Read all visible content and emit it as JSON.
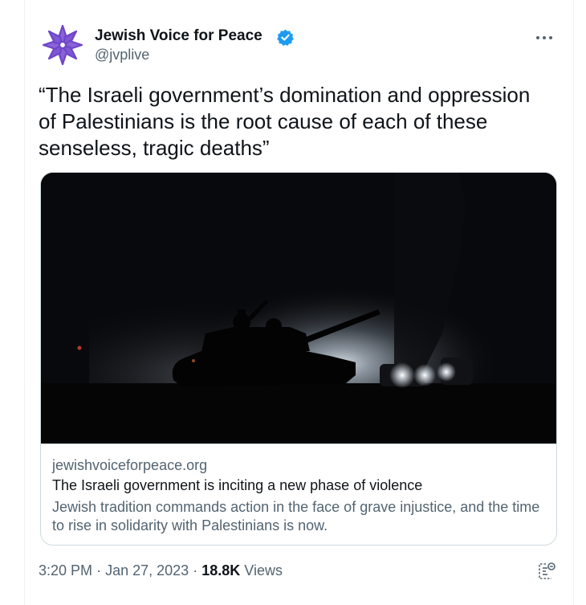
{
  "author": {
    "name": "Jewish Voice for Peace",
    "handle": "@jvplive",
    "verified": true
  },
  "tweet": {
    "text": "“The Israeli government’s domination and oppression of Palestinians is the root cause of each of these senseless, tragic deaths”"
  },
  "card": {
    "domain": "jewishvoiceforpeace.org",
    "title": "The Israeli government is inciting a new phase of violence",
    "description": "Jewish tradition commands action in the face of grave injustice, and the time to rise in solidarity with Palestinians is now."
  },
  "meta": {
    "time": "3:20 PM",
    "separator": "·",
    "date": "Jan 27, 2023",
    "views_count": "18.8K",
    "views_label": "Views"
  },
  "icons": {
    "avatar": "star-logo-icon",
    "verified": "verified-badge-icon",
    "more": "more-options-icon",
    "analytics": "analytics-icon"
  },
  "colors": {
    "text_primary": "#0f1419",
    "text_secondary": "#536471",
    "verified_blue": "#1d9bf0",
    "logo_purple": "#6f46c9",
    "border": "#cfd9de"
  }
}
